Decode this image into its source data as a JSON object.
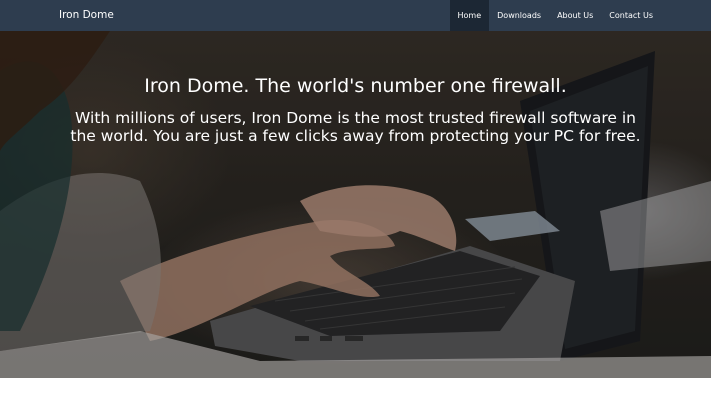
{
  "navbar": {
    "brand": "Iron Dome",
    "items": [
      {
        "label": "Home",
        "active": true
      },
      {
        "label": "Downloads",
        "active": false
      },
      {
        "label": "About Us",
        "active": false
      },
      {
        "label": "Contact Us",
        "active": false
      }
    ]
  },
  "hero": {
    "title": "Iron Dome. The world's number one firewall.",
    "text": "With millions of users, Iron Dome is the most trusted firewall software in the world. You are just a few clicks away from protecting your PC for free."
  },
  "colors": {
    "navbar_bg": "#2e3d4f",
    "nav_active_bg": "#1c2734",
    "text": "#ffffff"
  }
}
